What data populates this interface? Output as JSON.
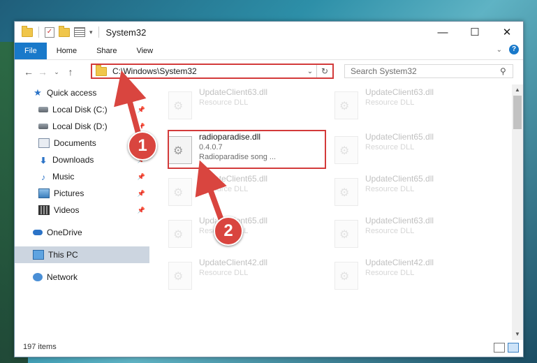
{
  "window": {
    "title": "System32"
  },
  "ribbon": {
    "tabs": [
      "File",
      "Home",
      "Share",
      "View"
    ]
  },
  "address": {
    "path": "C:\\Windows\\System32",
    "refresh_glyph": "↻"
  },
  "search": {
    "placeholder": "Search System32"
  },
  "sidebar": {
    "items": [
      {
        "label": "Quick access",
        "icon": "star-icon"
      },
      {
        "label": "Local Disk (C:)",
        "icon": "disk-icon",
        "pinned": true
      },
      {
        "label": "Local Disk (D:)",
        "icon": "disk-icon",
        "pinned": true
      },
      {
        "label": "Documents",
        "icon": "documents-icon",
        "pinned": true
      },
      {
        "label": "Downloads",
        "icon": "downloads-icon",
        "pinned": true
      },
      {
        "label": "Music",
        "icon": "music-icon",
        "pinned": true
      },
      {
        "label": "Pictures",
        "icon": "pictures-icon",
        "pinned": true
      },
      {
        "label": "Videos",
        "icon": "videos-icon",
        "pinned": true
      },
      {
        "label": "OneDrive",
        "icon": "onedrive-icon"
      },
      {
        "label": "This PC",
        "icon": "this-pc-icon",
        "selected": true
      },
      {
        "label": "Network",
        "icon": "network-icon"
      }
    ]
  },
  "files": {
    "highlighted": {
      "name": "radioparadise.dll",
      "version": "0.4.0.7",
      "description": "Radioparadise song ..."
    },
    "ghost": [
      {
        "name": "UpdateClient63.dll",
        "type": "Resource DLL"
      },
      {
        "name": "UpdateClient63.dll",
        "type": "Resource DLL"
      },
      {
        "name": "UpdateClient65.dll",
        "type": "Resource DLL"
      },
      {
        "name": "UpdateClient65.dll",
        "type": "Resource DLL"
      },
      {
        "name": "UpdateClient65.dll",
        "type": "Resource DLL"
      },
      {
        "name": "UpdateClient65.dll",
        "type": "Resource DLL"
      },
      {
        "name": "UpdateClient65.dll",
        "type": "Resource DLL"
      },
      {
        "name": "UpdateClient63.dll",
        "type": "Resource DLL"
      },
      {
        "name": "UpdateClient42.dll",
        "type": "Resource DLL"
      },
      {
        "name": "UpdateClient42.dll",
        "type": "Resource DLL"
      }
    ]
  },
  "status": {
    "count": "197 items"
  },
  "annotations": {
    "step1": "1",
    "step2": "2",
    "color": "#d9453f"
  }
}
